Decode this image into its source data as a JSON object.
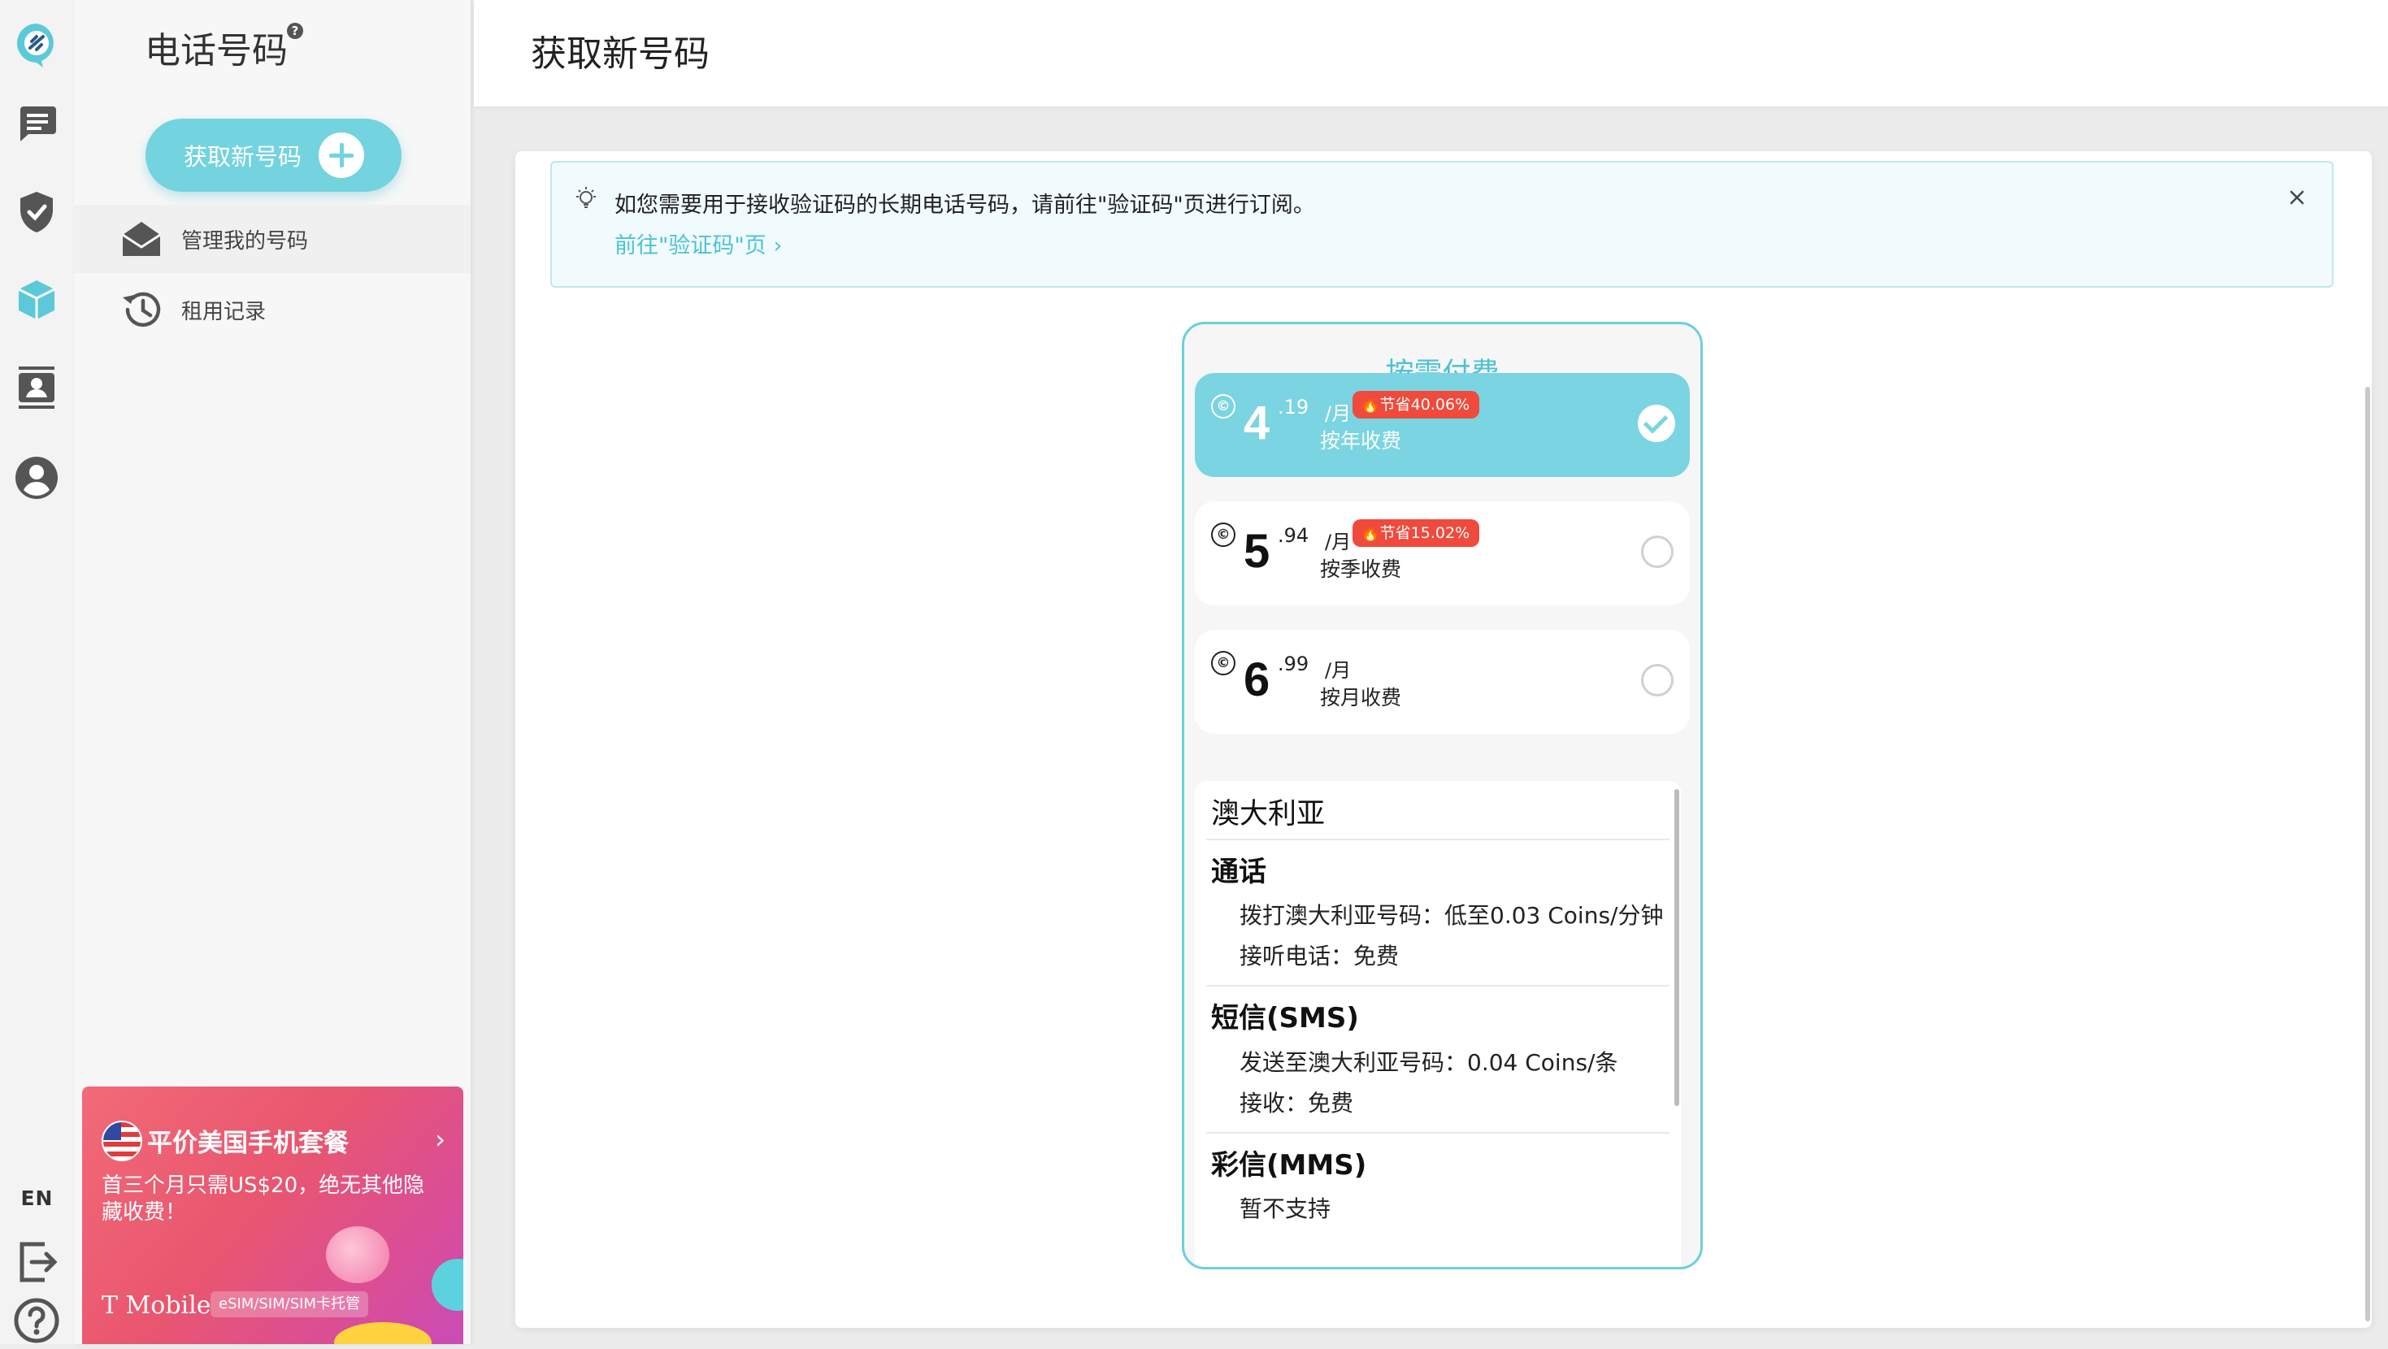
{
  "rail": {
    "lang": "EN"
  },
  "sidebar": {
    "title": "电话号码",
    "help": "?",
    "new_button": "获取新号码",
    "items": [
      {
        "label": "管理我的号码"
      },
      {
        "label": "租用记录"
      }
    ],
    "promo": {
      "title": "平价美国手机套餐",
      "text": "首三个月只需US$20，绝无其他隐藏收费！",
      "brand": "T Mobile",
      "tag": "eSIM/SIM/SIM卡托管"
    }
  },
  "topbar": {
    "title": "获取新号码"
  },
  "notice": {
    "text": "如您需要用于接收验证码的长期电话号码，请前往\"验证码\"页进行订阅。",
    "link": "前往\"验证码\"页"
  },
  "plan": {
    "title": "按需付费",
    "currency_symbol": "©",
    "options": [
      {
        "int": "4",
        "dec": ".19",
        "period": "/月",
        "label": "按年收费",
        "badge": "节省40.06%",
        "selected": true
      },
      {
        "int": "5",
        "dec": ".94",
        "period": "/月",
        "label": "按季收费",
        "badge": "节省15.02%",
        "selected": false
      },
      {
        "int": "6",
        "dec": ".99",
        "period": "/月",
        "label": "按月收费",
        "badge": "",
        "selected": false
      }
    ],
    "details": {
      "country": "澳大利亚",
      "call": {
        "title": "通话",
        "outgoing": "拨打澳大利亚号码：低至0.03 Coins/分钟",
        "incoming": "接听电话：免费"
      },
      "sms": {
        "title": "短信(SMS)",
        "send": "发送至澳大利亚号码：0.04 Coins/条",
        "receive": "接收：免费"
      },
      "mms": {
        "title": "彩信(MMS)",
        "status": "暂不支持"
      }
    }
  },
  "colors": {
    "accent": "#73d3df",
    "badge": "#f04a3c",
    "promo": "#ec5b73"
  }
}
